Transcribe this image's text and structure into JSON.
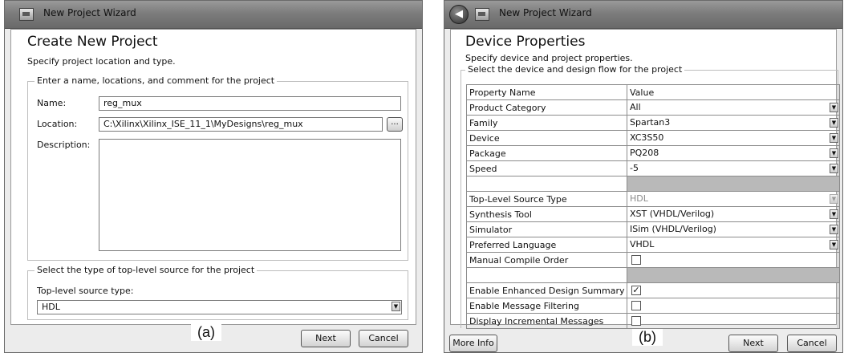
{
  "left": {
    "title": "New Project Wizard",
    "heading": "Create New Project",
    "subtitle": "Specify project location and type.",
    "group1_title": "Enter a name, locations, and comment for the project",
    "name_label": "Name:",
    "name_value": "reg_mux",
    "location_label": "Location:",
    "location_value": "C:\\Xilinx\\Xilinx_ISE_11_1\\MyDesigns\\reg_mux",
    "browse_label": "...",
    "description_label": "Description:",
    "description_value": "",
    "group2_title": "Select the type of top-level source for the project",
    "toplevel_label": "Top-level source type:",
    "toplevel_value": "HDL",
    "fig_label": "(a)",
    "next": "Next",
    "cancel": "Cancel"
  },
  "right": {
    "title": "New Project Wizard",
    "heading": "Device Properties",
    "subtitle": "Specify device and project properties.",
    "group_title": "Select the device and design flow for the project",
    "col_name": "Property Name",
    "col_value": "Value",
    "rows": [
      {
        "name": "Product Category",
        "value": "All"
      },
      {
        "name": "Family",
        "value": "Spartan3"
      },
      {
        "name": "Device",
        "value": "XC3S50"
      },
      {
        "name": "Package",
        "value": "PQ208"
      },
      {
        "name": "Speed",
        "value": "-5"
      },
      {
        "name": "Top-Level Source Type",
        "value": "HDL"
      },
      {
        "name": "Synthesis Tool",
        "value": "XST (VHDL/Verilog)"
      },
      {
        "name": "Simulator",
        "value": "ISim (VHDL/Verilog)"
      },
      {
        "name": "Preferred Language",
        "value": "VHDL"
      },
      {
        "name": "Manual Compile Order",
        "checked": false
      },
      {
        "name": "Enable Enhanced Design Summary",
        "checked": true
      },
      {
        "name": "Enable Message Filtering",
        "checked": false
      },
      {
        "name": "Display Incremental Messages",
        "checked": false
      }
    ],
    "more_info": "More Info",
    "fig_label": "(b)",
    "next": "Next",
    "cancel": "Cancel"
  }
}
